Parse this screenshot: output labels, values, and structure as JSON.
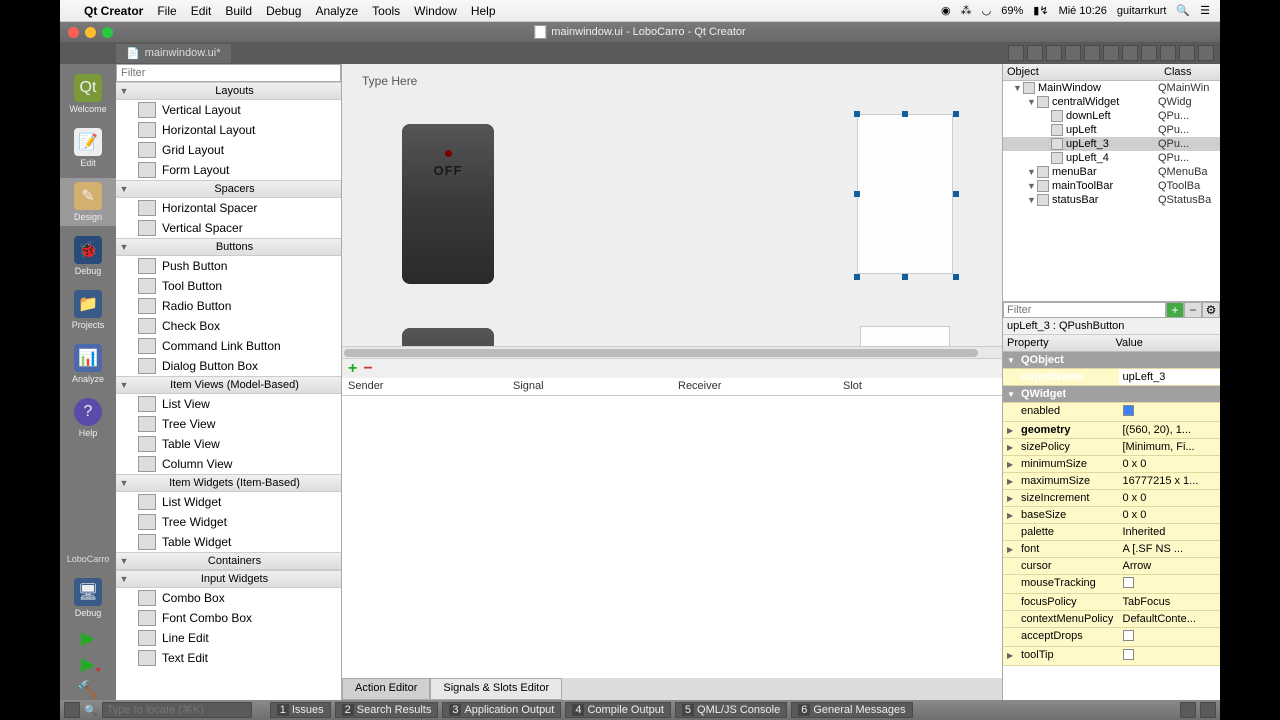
{
  "menubar": {
    "app": "Qt Creator",
    "items": [
      "File",
      "Edit",
      "Build",
      "Debug",
      "Analyze",
      "Tools",
      "Window",
      "Help"
    ],
    "battery": "69%",
    "time": "Mié 10:26",
    "user": "guitarrkurt"
  },
  "window": {
    "title": "mainwindow.ui - LoboCarro - Qt Creator",
    "tab": "mainwindow.ui*"
  },
  "leftbar": {
    "items": [
      "Welcome",
      "Edit",
      "Design",
      "Debug",
      "Projects",
      "Analyze",
      "Help"
    ],
    "project": "LoboCarro",
    "config": "Debug"
  },
  "widgetbox": {
    "filter_placeholder": "Filter",
    "categories": [
      {
        "name": "Layouts",
        "items": [
          "Vertical Layout",
          "Horizontal Layout",
          "Grid Layout",
          "Form Layout"
        ]
      },
      {
        "name": "Spacers",
        "items": [
          "Horizontal Spacer",
          "Vertical Spacer"
        ]
      },
      {
        "name": "Buttons",
        "items": [
          "Push Button",
          "Tool Button",
          "Radio Button",
          "Check Box",
          "Command Link Button",
          "Dialog Button Box"
        ]
      },
      {
        "name": "Item Views (Model-Based)",
        "items": [
          "List View",
          "Tree View",
          "Table View",
          "Column View"
        ]
      },
      {
        "name": "Item Widgets (Item-Based)",
        "items": [
          "List Widget",
          "Tree Widget",
          "Table Widget"
        ]
      },
      {
        "name": "Containers",
        "items": []
      },
      {
        "name": "Input Widgets",
        "items": [
          "Combo Box",
          "Font Combo Box",
          "Line Edit",
          "Text Edit"
        ]
      }
    ]
  },
  "canvas": {
    "typehere": "Type Here",
    "switch_label": "OFF"
  },
  "signals": {
    "columns": [
      "Sender",
      "Signal",
      "Receiver",
      "Slot"
    ],
    "tabs": [
      "Action Editor",
      "Signals & Slots Editor"
    ]
  },
  "objtree": {
    "head": [
      "Object",
      "Class"
    ],
    "rows": [
      {
        "name": "MainWindow",
        "class": "QMainWin",
        "indent": 0
      },
      {
        "name": "centralWidget",
        "class": "QWidg",
        "indent": 1
      },
      {
        "name": "downLeft",
        "class": "QPu...",
        "indent": 2
      },
      {
        "name": "upLeft",
        "class": "QPu...",
        "indent": 2
      },
      {
        "name": "upLeft_3",
        "class": "QPu...",
        "indent": 2,
        "sel": true
      },
      {
        "name": "upLeft_4",
        "class": "QPu...",
        "indent": 2
      },
      {
        "name": "menuBar",
        "class": "QMenuBa",
        "indent": 1
      },
      {
        "name": "mainToolBar",
        "class": "QToolBa",
        "indent": 1
      },
      {
        "name": "statusBar",
        "class": "QStatusBa",
        "indent": 1
      }
    ]
  },
  "props": {
    "filter_placeholder": "Filter",
    "objname": "upLeft_3 : QPushButton",
    "head": [
      "Property",
      "Value"
    ],
    "groups": {
      "qobject": "QObject",
      "qwidget": "QWidget"
    },
    "rows": [
      {
        "n": "objectName",
        "v": "upLeft_3",
        "group": "qobject",
        "sel": true,
        "bold": true
      },
      {
        "n": "enabled",
        "v": "check",
        "group": "qwidget"
      },
      {
        "n": "geometry",
        "v": "[(560, 20), 1...",
        "group": "qwidget",
        "bold": true,
        "exp": true
      },
      {
        "n": "sizePolicy",
        "v": "[Minimum, Fi...",
        "group": "qwidget",
        "exp": true
      },
      {
        "n": "minimumSize",
        "v": "0 x 0",
        "group": "qwidget",
        "exp": true
      },
      {
        "n": "maximumSize",
        "v": "16777215 x 1...",
        "group": "qwidget",
        "exp": true
      },
      {
        "n": "sizeIncrement",
        "v": "0 x 0",
        "group": "qwidget",
        "exp": true
      },
      {
        "n": "baseSize",
        "v": "0 x 0",
        "group": "qwidget",
        "exp": true
      },
      {
        "n": "palette",
        "v": "Inherited",
        "group": "qwidget"
      },
      {
        "n": "font",
        "v": "A   [.SF NS ...",
        "group": "qwidget",
        "exp": true
      },
      {
        "n": "cursor",
        "v": "Arrow",
        "group": "qwidget",
        "icon": true
      },
      {
        "n": "mouseTracking",
        "v": "",
        "group": "qwidget"
      },
      {
        "n": "focusPolicy",
        "v": "TabFocus",
        "group": "qwidget"
      },
      {
        "n": "contextMenuPolicy",
        "v": "DefaultConte...",
        "group": "qwidget"
      },
      {
        "n": "acceptDrops",
        "v": "",
        "group": "qwidget"
      },
      {
        "n": "toolTip",
        "v": "",
        "group": "qwidget",
        "exp": true
      }
    ]
  },
  "bottombar": {
    "locate_placeholder": "Type to locate (⌘K)",
    "tabs": [
      "Issues",
      "Search Results",
      "Application Output",
      "Compile Output",
      "QML/JS Console",
      "General Messages"
    ]
  }
}
